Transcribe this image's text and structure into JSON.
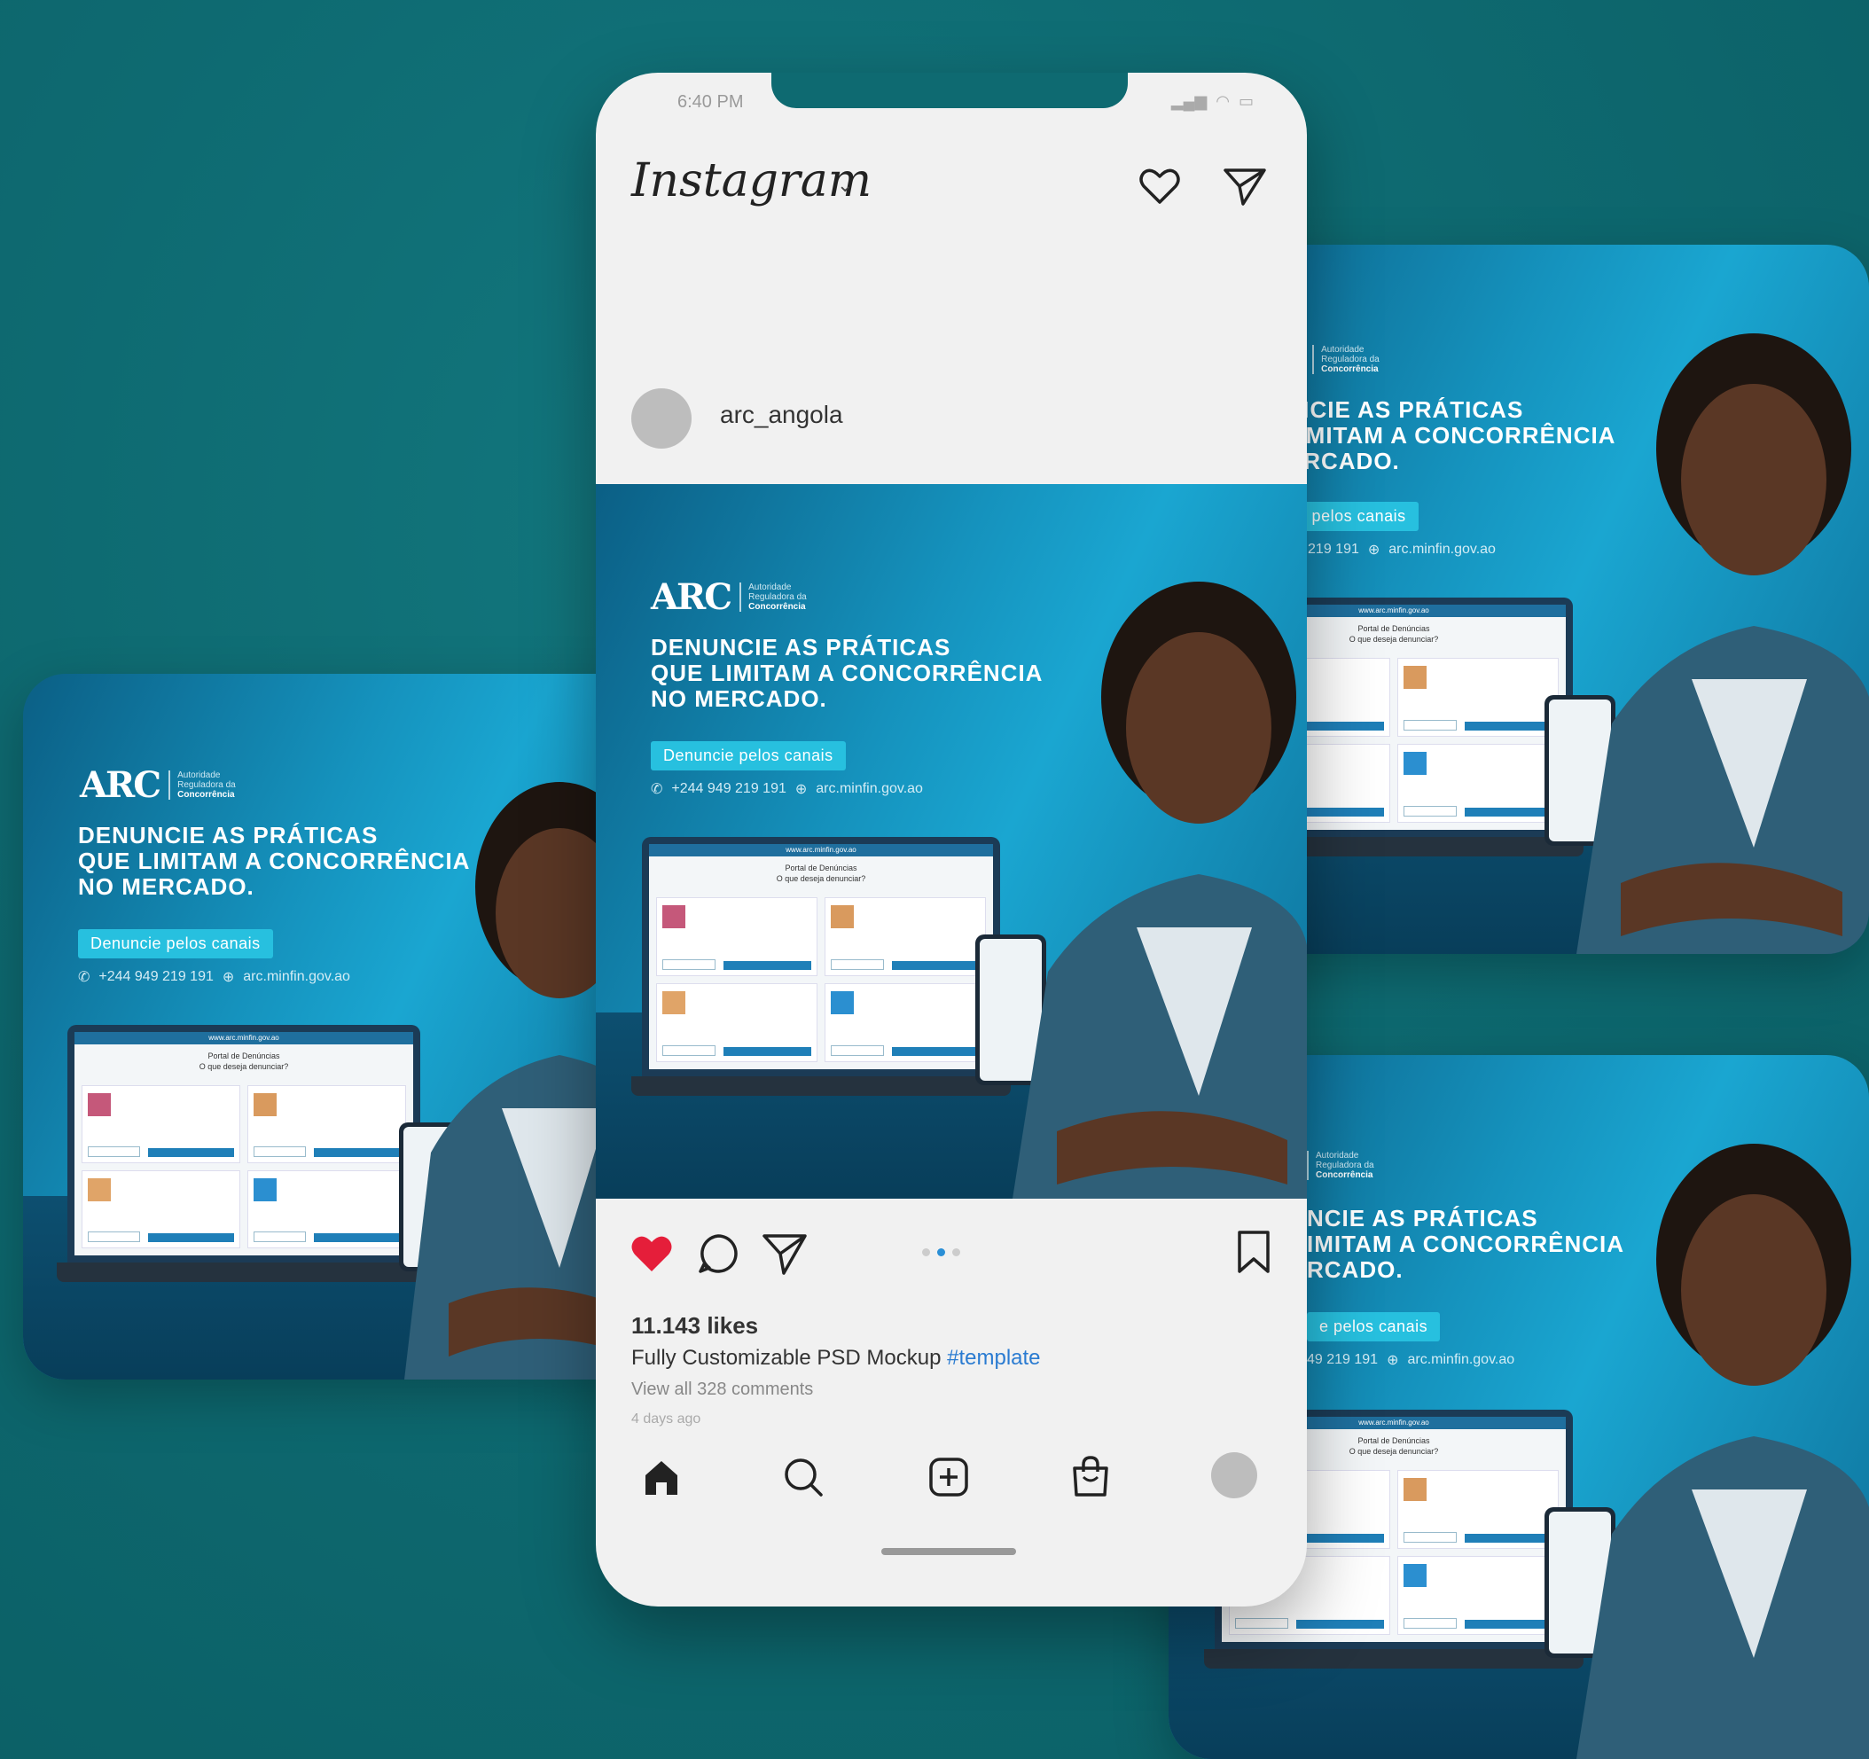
{
  "colors": {
    "background": "#0e6a71",
    "cta": "#27c0df",
    "like": "#e51e3a",
    "hashtag": "#2a7bd1"
  },
  "status": {
    "time": "6:40 PM"
  },
  "app": {
    "name": "Instagram"
  },
  "header": {
    "like_icon": "heart-outline-icon",
    "dm_icon": "paper-plane-icon"
  },
  "post": {
    "username": "arc_angola",
    "likes": "11.143 likes",
    "caption": "Fully Customizable PSD Mockup",
    "hashtag": "#template",
    "comments": "View all 328 comments",
    "time_ago": "4 days ago",
    "carousel_total": 3,
    "carousel_active": 2
  },
  "ad": {
    "logo": "ARC",
    "logo_sub": [
      "Autoridade",
      "Reguladora da",
      "Concorrência"
    ],
    "headline": [
      "DENUNCIE AS PRÁTICAS",
      "QUE LIMITAM A CONCORRÊNCIA",
      "NO MERCADO."
    ],
    "cta": "Denuncie pelos canais",
    "phone": "+244 949 219 191",
    "web": "arc.minfin.gov.ao",
    "portal_url": "www.arc.minfin.gov.ao",
    "portal_title": "Portal de Denúncias",
    "portal_question": "O que deseja denunciar?"
  },
  "card4": {
    "logo_sub": [
      "Autoridade",
      "Reguladora da",
      "Concorrência"
    ],
    "headline": [
      "NCIE AS PRÁTICAS",
      "IMITAM A CONCORRÊNCIA",
      "RCADO."
    ],
    "cta": "e pelos canais",
    "phone": "49 219 191",
    "web": "arc.minfin.gov.ao"
  },
  "tabbar": {
    "items": [
      "home-icon",
      "search-icon",
      "new-post-icon",
      "shop-icon",
      "profile-icon"
    ]
  }
}
